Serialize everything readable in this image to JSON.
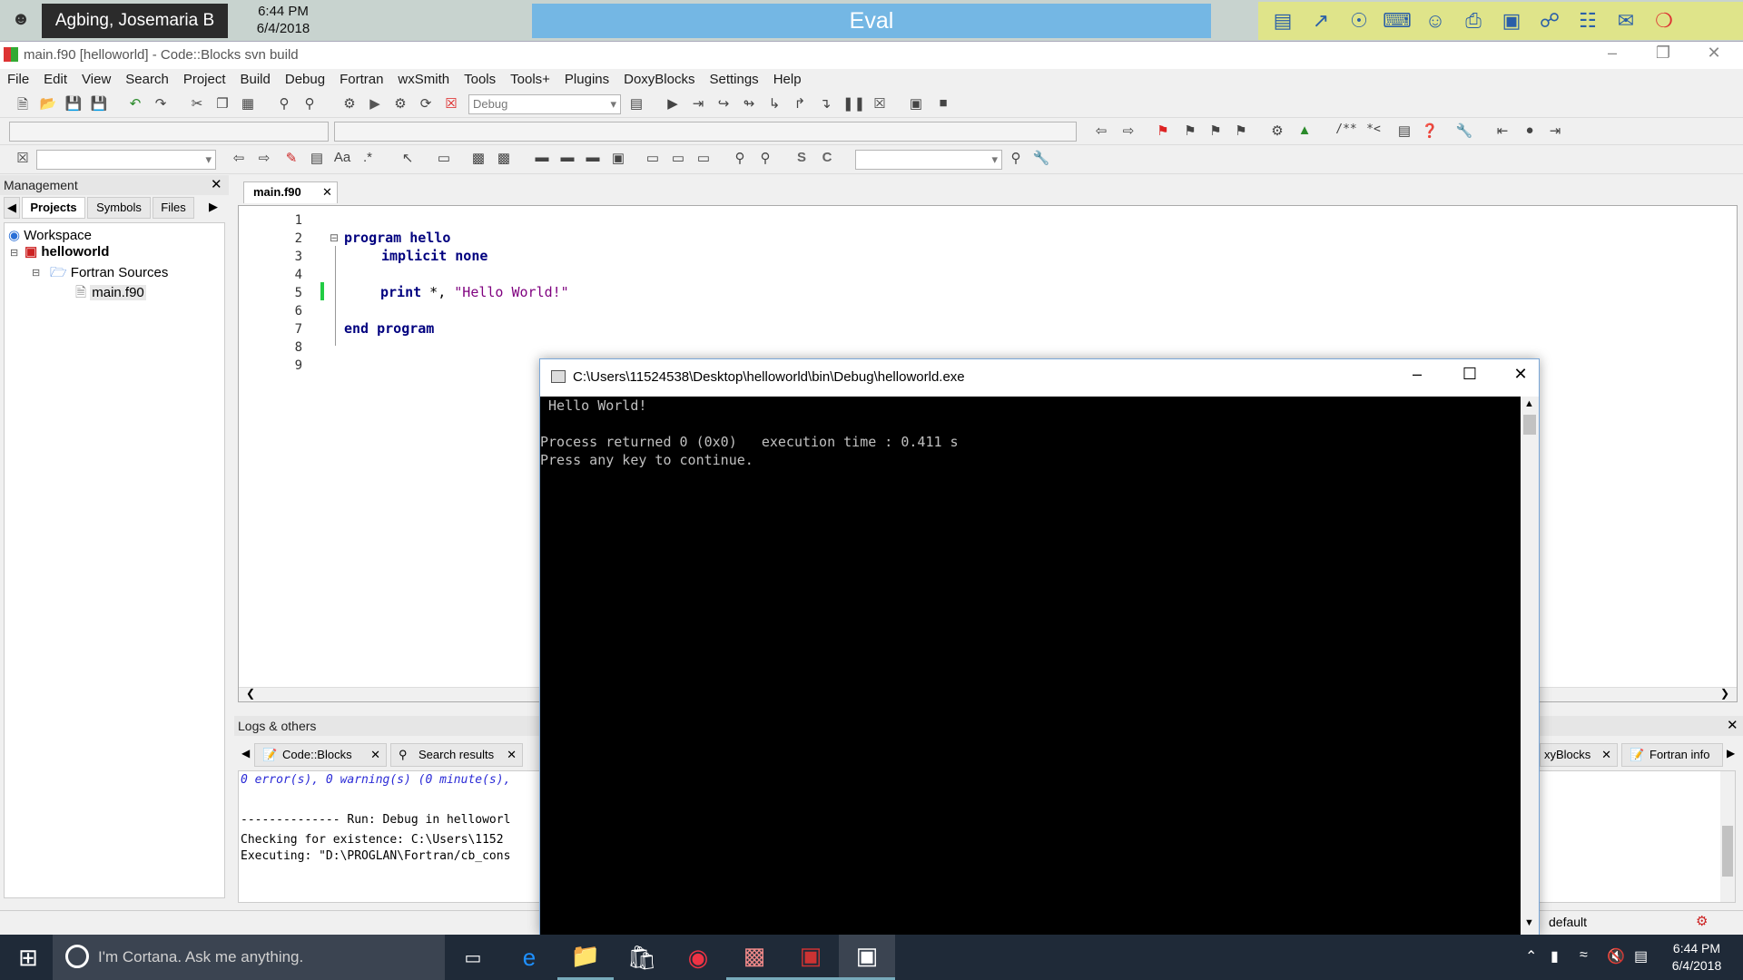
{
  "topbar": {
    "user_name": "Agbing, Josemaria B",
    "time": "6:44 PM",
    "date": "6/4/2018",
    "center_label": "Eval"
  },
  "window": {
    "title": "main.f90 [helloworld] - Code::Blocks svn build"
  },
  "menu": [
    "File",
    "Edit",
    "View",
    "Search",
    "Project",
    "Build",
    "Debug",
    "Fortran",
    "wxSmith",
    "Tools",
    "Tools+",
    "Plugins",
    "DoxyBlocks",
    "Settings",
    "Help"
  ],
  "toolbar": {
    "build_target": "Debug"
  },
  "management": {
    "title": "Management",
    "tabs": [
      "Projects",
      "Symbols",
      "Files"
    ],
    "tree": {
      "workspace": "Workspace",
      "project": "helloworld",
      "folder": "Fortran Sources",
      "file": "main.f90"
    }
  },
  "editor": {
    "tab_label": "main.f90",
    "line_numbers": [
      "1",
      "2",
      "3",
      "4",
      "5",
      "6",
      "7",
      "8",
      "9"
    ],
    "lines": {
      "l2": "program hello",
      "l3": "implicit none",
      "l5_kw": "print",
      "l5_rest": " *, ",
      "l5_str": "\"Hello World!\"",
      "l7": "end program"
    }
  },
  "logs": {
    "title": "Logs & others",
    "tabs": [
      "Code::Blocks",
      "Search results",
      "xyBlocks",
      "Fortran info"
    ],
    "lines": [
      "0 error(s), 0 warning(s) (0 minute(s),",
      "-------------- Run: Debug in helloworl",
      "Checking for existence: C:\\Users\\1152",
      "Executing: \"D:\\PROGLAN\\Fortran/cb_cons"
    ]
  },
  "statusbar": {
    "profile": "default"
  },
  "console": {
    "title": "C:\\Users\\11524538\\Desktop\\helloworld\\bin\\Debug\\helloworld.exe",
    "output": " Hello World!\n\nProcess returned 0 (0x0)   execution time : 0.411 s\nPress any key to continue."
  },
  "taskbar": {
    "search_placeholder": "I'm Cortana. Ask me anything.",
    "time": "6:44 PM",
    "date": "6/4/2018"
  }
}
